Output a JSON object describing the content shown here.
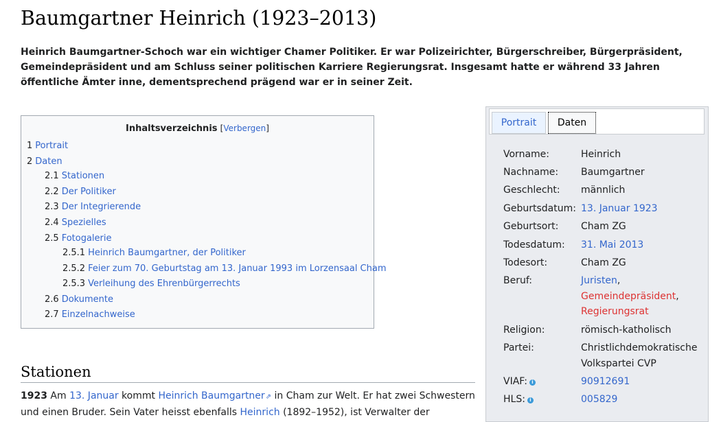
{
  "page_title": "Baumgartner Heinrich (1923–2013)",
  "intro": "Heinrich Baumgartner-Schoch war ein wichtiger Chamer Politiker. Er war Polizeirichter, Bürgerschreiber, Bürgerpräsident, Gemeindepräsident und am Schluss seiner politischen Karriere Regierungsrat. Insgesamt hatte er während 33 Jahren öffentliche Ämter inne, dementsprechend prägend war er in seiner Zeit.",
  "toc": {
    "title": "Inhaltsverzeichnis",
    "toggle_open": "[",
    "toggle_label": "Verbergen",
    "toggle_close": "]",
    "items": [
      {
        "num": "1",
        "label": "Portrait"
      },
      {
        "num": "2",
        "label": "Daten"
      },
      {
        "num": "2.1",
        "label": "Stationen"
      },
      {
        "num": "2.2",
        "label": "Der Politiker"
      },
      {
        "num": "2.3",
        "label": "Der Integrierende"
      },
      {
        "num": "2.4",
        "label": "Spezielles"
      },
      {
        "num": "2.5",
        "label": "Fotogalerie"
      },
      {
        "num": "2.5.1",
        "label": "Heinrich Baumgartner, der Politiker"
      },
      {
        "num": "2.5.2",
        "label": "Feier zum 70. Geburtstag am 13. Januar 1993 im Lorzensaal Cham"
      },
      {
        "num": "2.5.3",
        "label": "Verleihung des Ehrenbürgerrechts"
      },
      {
        "num": "2.6",
        "label": "Dokumente"
      },
      {
        "num": "2.7",
        "label": "Einzelnachweise"
      }
    ]
  },
  "section": {
    "heading": "Stationen",
    "year": "1923",
    "t1": " Am ",
    "l1": "13. Januar",
    "t2": " kommt ",
    "l2": "Heinrich Baumgartner",
    "t3": " in Cham zur Welt. Er hat zwei Schwestern und einen Bruder. Sein Vater heisst ebenfalls ",
    "l3": "Heinrich",
    "t4": " (1892–1952), ist Verwalter der"
  },
  "infobox": {
    "tabs": [
      "Portrait",
      "Daten"
    ],
    "vorname_label": "Vorname:",
    "vorname": "Heinrich",
    "nachname_label": "Nachname:",
    "nachname": "Baumgartner",
    "geschlecht_label": "Geschlecht:",
    "geschlecht": "männlich",
    "geburtsdatum_label": "Geburtsdatum:",
    "geburtsdatum": "13. Januar 1923",
    "geburtsort_label": "Geburtsort:",
    "geburtsort": "Cham ZG",
    "todesdatum_label": "Todesdatum:",
    "todesdatum": "31. Mai 2013",
    "todesort_label": "Todesort:",
    "todesort": "Cham ZG",
    "beruf_label": "Beruf:",
    "beruf_1": "Juristen",
    "beruf_2": "Gemeindepräsident",
    "beruf_3": "Regierungsrat",
    "religion_label": "Religion:",
    "religion": "römisch-katholisch",
    "partei_label": "Partei:",
    "partei": "Christlichdemokratische Volkspartei CVP",
    "viaf_label": "VIAF:",
    "viaf": "90912691",
    "hls_label": "HLS:",
    "hls": "005829",
    "info_icon": "i"
  }
}
